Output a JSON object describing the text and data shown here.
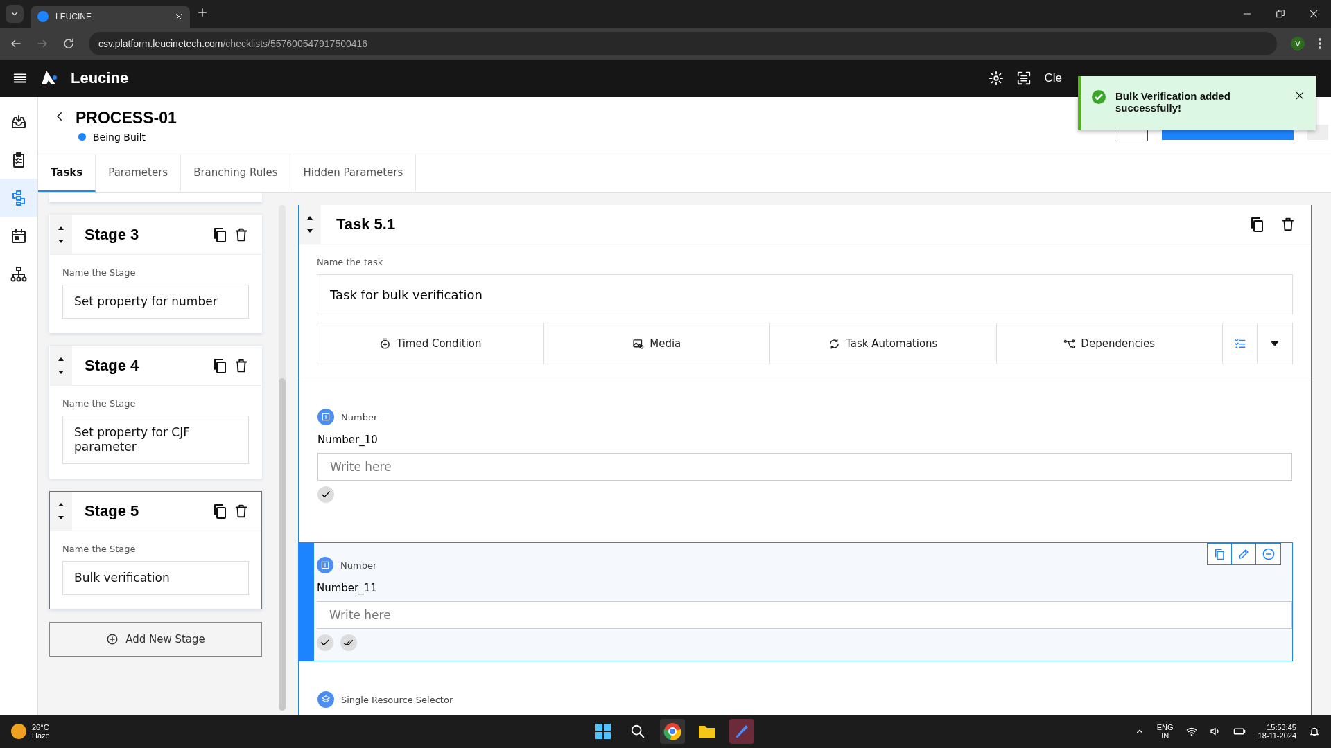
{
  "browser": {
    "tab_title": "LEUCINE",
    "url_host": "csv.platform.leucinetech.com",
    "url_path": "/checklists/557600547917500416",
    "profile": "V"
  },
  "app": {
    "brand": "Leucine",
    "header_links": [
      "Cle"
    ]
  },
  "process": {
    "title": "PROCESS-01",
    "status": "Being Built"
  },
  "toast": {
    "message": "Bulk Verification added successfully!"
  },
  "rail": [
    {
      "kind": "inbox",
      "selected": false
    },
    {
      "kind": "checklist",
      "selected": false
    },
    {
      "kind": "flow",
      "selected": true
    },
    {
      "kind": "calendar",
      "selected": false
    },
    {
      "kind": "hierarchy",
      "selected": false
    }
  ],
  "tabs": [
    {
      "label": "Tasks",
      "selected": true
    },
    {
      "label": "Parameters",
      "selected": false
    },
    {
      "label": "Branching Rules",
      "selected": false
    },
    {
      "label": "Hidden Parameters",
      "selected": false
    }
  ],
  "stages": [
    {
      "title": "Stage 3",
      "field_label": "Name the Stage",
      "value": "Set property for number",
      "selected": false
    },
    {
      "title": "Stage 4",
      "field_label": "Name the Stage",
      "value": "Set property for CJF parameter",
      "selected": false
    },
    {
      "title": "Stage 5",
      "field_label": "Name the Stage",
      "value": "Bulk verification",
      "selected": true
    }
  ],
  "add_stage": "Add New Stage",
  "task": {
    "title": "Task 5.1",
    "name_label": "Name the task",
    "name_value": "Task for bulk verification",
    "actions": [
      {
        "kind": "timer",
        "label": "Timed Condition"
      },
      {
        "kind": "media",
        "label": "Media"
      },
      {
        "kind": "automation",
        "label": "Task Automations"
      },
      {
        "kind": "dependency",
        "label": "Dependencies"
      }
    ],
    "parameters": [
      {
        "kind": "number",
        "type_label": "Number",
        "name": "Number_10",
        "placeholder": "Write here",
        "selected": false,
        "verifications": [
          {
            "kind": "self"
          }
        ]
      },
      {
        "kind": "number",
        "type_label": "Number",
        "name": "Number_11",
        "placeholder": "Write here",
        "selected": true,
        "verifications": [
          {
            "kind": "self"
          },
          {
            "kind": "peer"
          }
        ]
      },
      {
        "kind": "resource",
        "type_label": "Single Resource Selector"
      }
    ]
  },
  "taskbar": {
    "temperature": "26°C",
    "weather": "Haze",
    "language": "ENG",
    "region": "IN",
    "time": "15:53:45",
    "date": "18-11-2024"
  }
}
